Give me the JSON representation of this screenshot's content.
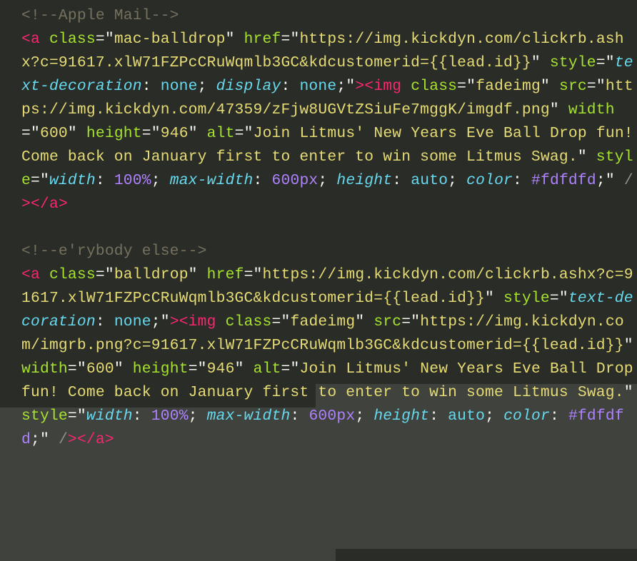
{
  "code": {
    "comment1": "<!--Apple Mail-->",
    "block1": {
      "a_open_tag": "a",
      "a_close_tag": "a",
      "a_class_attr": "class",
      "a_class_val": "mac-balldrop",
      "a_href_attr": "href",
      "a_href_val": "https://img.kickdyn.com/clickrb.ashx?c=91617.xlW71FZPcCRuWqmlb3GC&kdcustomerid={{lead.id}}",
      "a_style_attr": "style",
      "a_style_props": {
        "text_decoration_key": "text-decoration",
        "text_decoration_val": "none",
        "display_key": "display",
        "display_val": "none"
      },
      "img_tag": "img",
      "img_class_attr": "class",
      "img_class_val": "fadeimg",
      "img_src_attr": "src",
      "img_src_val": "https://img.kickdyn.com/47359/zFjw8UGVtZSiuFe7mggK/imgdf.png",
      "img_width_attr": "width",
      "img_width_val": "600",
      "img_height_attr": "height",
      "img_height_val": "946",
      "img_alt_attr": "alt",
      "img_alt_val": "Join Litmus' New Years Eve Ball Drop fun! Come back on January first to enter to win some Litmus Swag.",
      "img_style_attr": "style",
      "img_style_props": {
        "width_key": "width",
        "width_val": "100%",
        "max_width_key": "max-width",
        "max_width_val": "600px",
        "height_key": "height",
        "height_val": "auto",
        "color_key": "color",
        "color_val": "#fdfdfd"
      }
    },
    "comment2": "<!--e'rybody else-->",
    "block2": {
      "a_open_tag": "a",
      "a_close_tag": "a",
      "a_class_attr": "class",
      "a_class_val": "balldrop",
      "a_href_attr": "href",
      "a_href_val": "https://img.kickdyn.com/clickrb.ashx?c=91617.xlW71FZPcCRuWqmlb3GC&kdcustomerid={{lead.id}}",
      "a_style_attr": "style",
      "a_style_props": {
        "text_decoration_key": "text-decoration",
        "text_decoration_val": "none"
      },
      "img_tag": "img",
      "img_class_attr": "class",
      "img_class_val": "fadeimg",
      "img_src_attr": "src",
      "img_src_val": "https://img.kickdyn.com/imgrb.png?c=91617.xlW71FZPcCRuWqmlb3GC&kdcustomerid={{lead.id}}",
      "img_width_attr": "width",
      "img_width_val": "600",
      "img_height_attr": "height",
      "img_height_val": "946",
      "img_alt_attr": "alt",
      "img_alt_val": "Join Litmus' New Years Eve Ball Drop fun! Come back on January first to enter to win some Litmus Swag.",
      "img_style_attr": "style",
      "img_style_props": {
        "width_key": "width",
        "width_val": "100%",
        "max_width_key": "max-width",
        "max_width_val": "600px",
        "height_key": "height",
        "height_val": "auto",
        "color_key": "color",
        "color_val": "#fdfdfd"
      }
    }
  }
}
